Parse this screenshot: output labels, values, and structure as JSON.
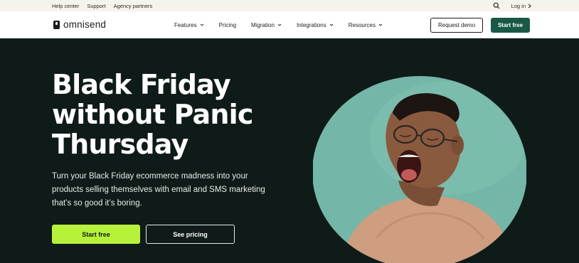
{
  "utility": {
    "links": [
      "Help center",
      "Support",
      "Agency partners"
    ],
    "login_label": "Log in"
  },
  "nav": {
    "logo_text": "omnisend",
    "items": [
      {
        "label": "Features",
        "has_dropdown": true
      },
      {
        "label": "Pricing",
        "has_dropdown": false
      },
      {
        "label": "Migration",
        "has_dropdown": true
      },
      {
        "label": "Integrations",
        "has_dropdown": true
      },
      {
        "label": "Resources",
        "has_dropdown": true
      }
    ],
    "request_demo_label": "Request demo",
    "start_free_label": "Start free"
  },
  "hero": {
    "title_lines": [
      "Black Friday",
      "without Panic",
      "Thursday"
    ],
    "description": "Turn your Black Friday ecommerce madness into your products selling themselves with email and SMS marketing that’s so good it’s boring.",
    "primary_cta": "Start free",
    "secondary_cta": "See pricing"
  },
  "colors": {
    "hero_bg": "#0f1b18",
    "brand_green": "#195846",
    "lime": "#b6f23a",
    "circle_teal": "#74b7a8"
  },
  "icons": {
    "search": "search-icon",
    "chevron": "chevron-down-icon",
    "arrow": "chevron-right-icon"
  }
}
